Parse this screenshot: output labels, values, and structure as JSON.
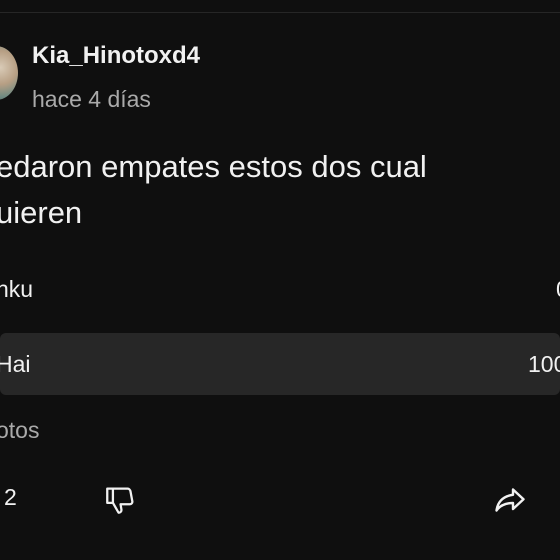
{
  "post": {
    "author": "Kia_Hinotoxd4",
    "timestamp": "hace 4 días",
    "text_line1": "edaron empates estos dos cual",
    "text_line2": "uieren"
  },
  "poll": {
    "options": [
      {
        "label": "nku",
        "percent": "0"
      },
      {
        "label": "Hai",
        "percent": "100"
      }
    ],
    "votes_text": "otos"
  },
  "actions": {
    "like_count": "2"
  },
  "icons": {
    "dislike": "thumbs-down-icon",
    "share": "share-icon"
  },
  "colors": {
    "background": "#0f0f0f",
    "selected_option_bg": "#272727",
    "secondary_text": "#aaaaaa"
  }
}
